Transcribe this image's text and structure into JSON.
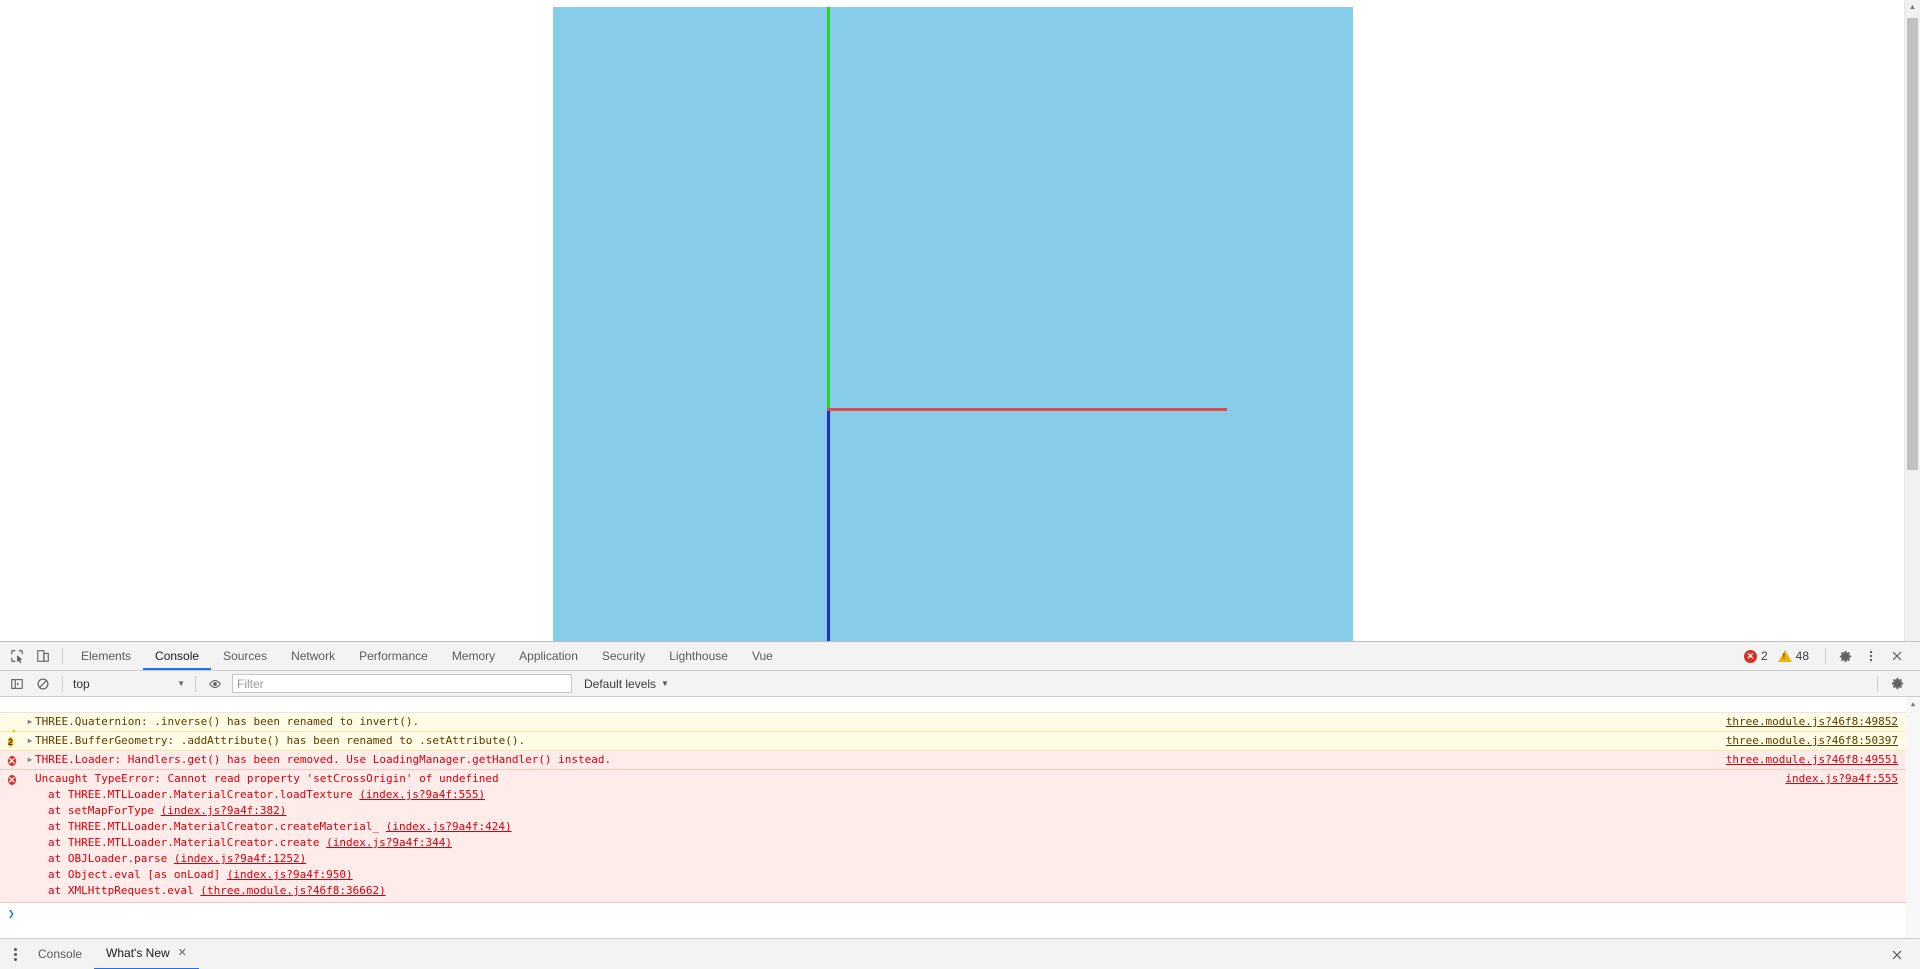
{
  "viewport": {
    "background_color": "#87cdea",
    "axes": [
      {
        "name": "y-axis",
        "color": "#25d52a",
        "orientation": "vertical-up"
      },
      {
        "name": "x-axis",
        "color": "#e24a4a",
        "orientation": "horizontal-right"
      },
      {
        "name": "z-axis",
        "color": "#1f2fe0",
        "orientation": "vertical-down"
      }
    ]
  },
  "devtools": {
    "main_tabs": [
      {
        "label": "Elements",
        "active": false
      },
      {
        "label": "Console",
        "active": true
      },
      {
        "label": "Sources",
        "active": false
      },
      {
        "label": "Network",
        "active": false
      },
      {
        "label": "Performance",
        "active": false
      },
      {
        "label": "Memory",
        "active": false
      },
      {
        "label": "Application",
        "active": false
      },
      {
        "label": "Security",
        "active": false
      },
      {
        "label": "Lighthouse",
        "active": false
      },
      {
        "label": "Vue",
        "active": false
      }
    ],
    "status": {
      "error_count": "2",
      "warning_count": "48"
    },
    "filterbar": {
      "context": "top",
      "filter_placeholder": "Filter",
      "filter_value": "",
      "levels": "Default levels",
      "caret": "▼"
    },
    "messages": [
      {
        "kind": "clipped",
        "text": "",
        "source": ""
      },
      {
        "kind": "warn",
        "icon": "warning-triangle-icon",
        "icon_text": "",
        "expandable": true,
        "text": "THREE.Quaternion: .inverse() has been renamed to invert().",
        "source": "three.module.js?46f8:49852"
      },
      {
        "kind": "warn",
        "icon": "warning-count-icon",
        "icon_text": "2",
        "expandable": true,
        "text": "THREE.BufferGeometry: .addAttribute() has been renamed to .setAttribute().",
        "source": "three.module.js?46f8:50397"
      },
      {
        "kind": "error",
        "icon": "error-circle-icon",
        "icon_text": "✕",
        "expandable": true,
        "text": "THREE.Loader: Handlers.get() has been removed. Use LoadingManager.getHandler() instead.",
        "source": "three.module.js?46f8:49551"
      },
      {
        "kind": "error",
        "icon": "error-circle-icon",
        "icon_text": "✕",
        "expandable": false,
        "text": "Uncaught TypeError: Cannot read property 'setCrossOrigin' of undefined",
        "source": "index.js?9a4f:555",
        "stack": [
          {
            "fn": "at THREE.MTLLoader.MaterialCreator.loadTexture ",
            "loc": "(index.js?9a4f:555)"
          },
          {
            "fn": "at setMapForType ",
            "loc": "(index.js?9a4f:382)"
          },
          {
            "fn": "at THREE.MTLLoader.MaterialCreator.createMaterial_ ",
            "loc": "(index.js?9a4f:424)"
          },
          {
            "fn": "at THREE.MTLLoader.MaterialCreator.create ",
            "loc": "(index.js?9a4f:344)"
          },
          {
            "fn": "at OBJLoader.parse ",
            "loc": "(index.js?9a4f:1252)"
          },
          {
            "fn": "at Object.eval [as onLoad] ",
            "loc": "(index.js?9a4f:950)"
          },
          {
            "fn": "at XMLHttpRequest.eval ",
            "loc": "(three.module.js?46f8:36662)"
          }
        ]
      }
    ],
    "prompt": {
      "caret": "❯",
      "value": ""
    },
    "drawer_tabs": [
      {
        "label": "Console",
        "active": false,
        "closable": false
      },
      {
        "label": "What's New",
        "active": true,
        "closable": true
      }
    ],
    "close_glyph": "✕"
  }
}
